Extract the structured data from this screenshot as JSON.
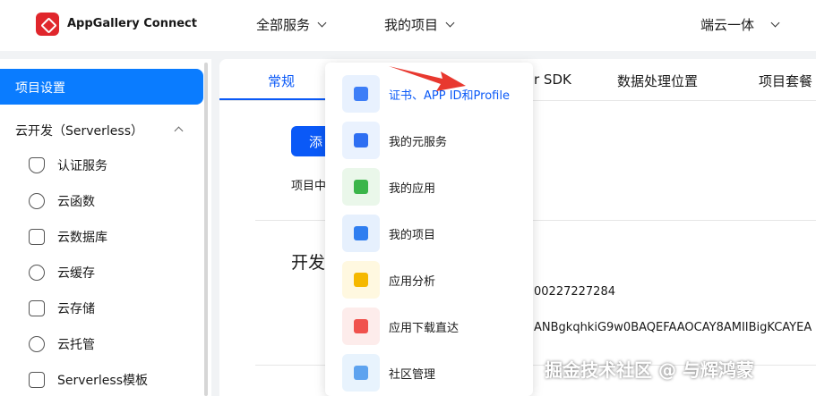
{
  "header": {
    "brand": "AppGallery Connect",
    "nav": [
      "全部服务",
      "我的项目"
    ],
    "right": "端云一体"
  },
  "sidebar": {
    "active": "项目设置",
    "group": "云开发（Serverless）",
    "items": [
      {
        "label": "认证服务",
        "icon": "shield-icon"
      },
      {
        "label": "云函数",
        "icon": "cloud-function-icon"
      },
      {
        "label": "云数据库",
        "icon": "database-icon"
      },
      {
        "label": "云缓存",
        "icon": "cloud-cache-icon"
      },
      {
        "label": "云存储",
        "icon": "storage-icon"
      },
      {
        "label": "云托管",
        "icon": "globe-icon"
      },
      {
        "label": "Serverless模板",
        "icon": "template-icon"
      }
    ]
  },
  "main": {
    "tabs": [
      "常规",
      "r SDK",
      "数据处理位置",
      "项目套餐"
    ],
    "add_button": "添",
    "hint": "项目中",
    "section_title": "开发",
    "value_1": "00227227284",
    "value_2": "ANBgkqhkiG9w0BAQEFAAOCAY8AMIIBigKCAYEA"
  },
  "dropdown": {
    "items": [
      {
        "label": "证书、APP ID和Profile",
        "icon": "hmos-certificate-icon",
        "bg": "#e8f1fe",
        "fg": "#3d7ef7",
        "highlight": true
      },
      {
        "label": "我的元服务",
        "icon": "atomic-service-icon",
        "bg": "#eaf2fe",
        "fg": "#2e6ff2",
        "highlight": false
      },
      {
        "label": "我的应用",
        "icon": "app-grid-icon",
        "bg": "#eaf7ea",
        "fg": "#3bb54a",
        "highlight": false
      },
      {
        "label": "我的项目",
        "icon": "project-icon",
        "bg": "#e6f0fd",
        "fg": "#2f7ef0",
        "highlight": false
      },
      {
        "label": "应用分析",
        "icon": "analytics-icon",
        "bg": "#fff8e0",
        "fg": "#f5b800",
        "highlight": false
      },
      {
        "label": "应用下载直达",
        "icon": "download-direct-icon",
        "bg": "#fdeceb",
        "fg": "#f0524d",
        "highlight": false
      },
      {
        "label": "社区管理",
        "icon": "community-icon",
        "bg": "#e8f3fd",
        "fg": "#5ea3ef",
        "highlight": false
      }
    ]
  },
  "colors": {
    "accent": "#0a59f7",
    "active_sidebar": "#0a7cff",
    "arrow": "#e8382f"
  },
  "watermark": "掘金技术社区 @ 与辉鸿蒙"
}
